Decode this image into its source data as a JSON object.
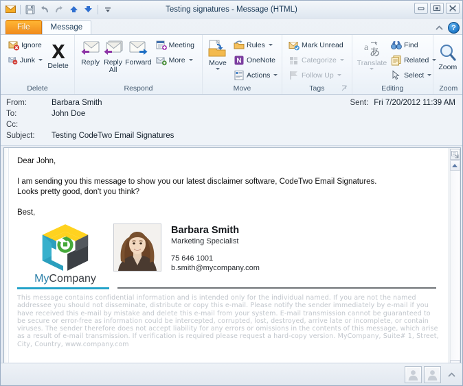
{
  "window": {
    "title": "Testing signatures  -  Message (HTML)",
    "controls": {
      "minimize": "minimize",
      "restore": "restore",
      "close": "close"
    }
  },
  "quick_access": {
    "items": [
      {
        "name": "mail-envelope-icon",
        "label": "Message"
      },
      {
        "name": "save-icon",
        "label": "Save"
      },
      {
        "name": "undo-icon",
        "label": "Undo"
      },
      {
        "name": "redo-icon",
        "label": "Redo"
      },
      {
        "name": "previous-item-icon",
        "label": "Previous Item"
      },
      {
        "name": "next-item-icon",
        "label": "Next Item"
      },
      {
        "name": "customize-qat-icon",
        "label": "Customize Quick Access Toolbar"
      }
    ]
  },
  "tabs": {
    "file": "File",
    "message": "Message",
    "collapse_ribbon": "collapse-ribbon",
    "help": "?"
  },
  "ribbon": {
    "groups": [
      {
        "name": "delete",
        "label": "Delete",
        "small_items": [
          {
            "label": "Ignore",
            "icon": "ignore-icon",
            "caret": false,
            "disabled": false
          },
          {
            "label": "Junk",
            "icon": "junk-icon",
            "caret": true,
            "disabled": false
          }
        ],
        "big_items": [
          {
            "label": "Delete",
            "icon": "delete-x-icon"
          }
        ]
      },
      {
        "name": "respond",
        "label": "Respond",
        "big_items": [
          {
            "label": "Reply",
            "icon": "reply-icon"
          },
          {
            "label": "Reply All",
            "icon": "reply-all-icon"
          },
          {
            "label": "Forward",
            "icon": "forward-icon"
          }
        ],
        "small_items": [
          {
            "label": "Meeting",
            "icon": "meeting-icon",
            "caret": false,
            "disabled": false
          },
          {
            "label": "More",
            "icon": "more-respond-icon",
            "caret": true,
            "disabled": false
          }
        ]
      },
      {
        "name": "move",
        "label": "Move",
        "big_items": [
          {
            "label": "Move",
            "icon": "move-folder-icon",
            "caret": true
          }
        ],
        "small_items": [
          {
            "label": "Rules",
            "icon": "rules-icon",
            "caret": true,
            "disabled": false
          },
          {
            "label": "OneNote",
            "icon": "onenote-icon",
            "caret": false,
            "disabled": false
          },
          {
            "label": "Actions",
            "icon": "actions-icon",
            "caret": true,
            "disabled": false
          }
        ]
      },
      {
        "name": "tags",
        "label": "Tags",
        "has_dialog_launcher": true,
        "small_items": [
          {
            "label": "Mark Unread",
            "icon": "mark-unread-icon",
            "caret": false,
            "disabled": false
          },
          {
            "label": "Categorize",
            "icon": "categorize-icon",
            "caret": true,
            "disabled": true
          },
          {
            "label": "Follow Up",
            "icon": "follow-up-flag-icon",
            "caret": true,
            "disabled": true
          }
        ]
      },
      {
        "name": "editing",
        "label": "Editing",
        "big_items": [
          {
            "label": "Translate",
            "icon": "translate-icon",
            "caret": true,
            "disabled": true
          }
        ],
        "small_items": [
          {
            "label": "Find",
            "icon": "find-binoculars-icon",
            "caret": false,
            "disabled": false
          },
          {
            "label": "Related",
            "icon": "related-icon",
            "caret": true,
            "disabled": false
          },
          {
            "label": "Select",
            "icon": "select-cursor-icon",
            "caret": true,
            "disabled": false
          }
        ]
      },
      {
        "name": "zoom",
        "label": "Zoom",
        "big_items": [
          {
            "label": "Zoom",
            "icon": "zoom-magnifier-icon"
          }
        ]
      }
    ]
  },
  "message_header": {
    "from_label": "From:",
    "from_value": "Barbara Smith",
    "to_label": "To:",
    "to_value": "John Doe",
    "cc_label": "Cc:",
    "cc_value": "",
    "subject_label": "Subject:",
    "subject_value": "Testing CodeTwo Email Signatures",
    "sent_label": "Sent:",
    "sent_value": "Fri 7/20/2012 11:39 AM"
  },
  "body": {
    "greeting": "Dear John,",
    "paragraph1": "I am sending you this message to show you our latest disclaimer software, CodeTwo Email Signatures.",
    "paragraph2": "Looks pretty good, don't you think?",
    "closing": "Best,"
  },
  "signature": {
    "logo_alt": "mycompany-logo",
    "company_my": "My",
    "company_rest": "Company",
    "photo_alt": "barbara-smith-photo",
    "name": "Barbara Smith",
    "role": "Marketing Specialist",
    "phone": "75 646 1001",
    "email": "b.smith@mycompany.com",
    "accent_color": "#24a3c9",
    "disclaimer": "This message contains confidential information and is intended only for the individual named. If you are not the named addressee you should not disseminate, distribute or copy this e-mail. Please notify the sender immediately by e-mail if you have received this e-mail by mistake and delete this e-mail from your system. E-mail transmission cannot be guaranteed to be secure or error-free as information could be intercepted, corrupted, lost, destroyed, arrive late or incomplete, or contain viruses. The sender therefore does not accept liability for any errors or omissions in the contents of this message, which arise as a result of e-mail transmission. If verification is required please request a hard-copy version. MyCompany, Suite# 1, Street, City, Country, www.company.com"
  },
  "scrollbar": {
    "top_icon": "scroll-split-icon",
    "up_arrow": "scroll-up-arrow",
    "down_arrow": "scroll-down-arrow"
  },
  "status_bar": {
    "people_pane_1": "people-pane-contact-1",
    "people_pane_2": "people-pane-contact-2",
    "expand_chevron": "expand-people-pane"
  },
  "colors": {
    "file_tab": "#f08a1c",
    "accent_teal": "#24a3c9",
    "logo_yellow": "#ffd21f",
    "logo_dark": "#3c4045",
    "logo_green": "#46a93a"
  }
}
